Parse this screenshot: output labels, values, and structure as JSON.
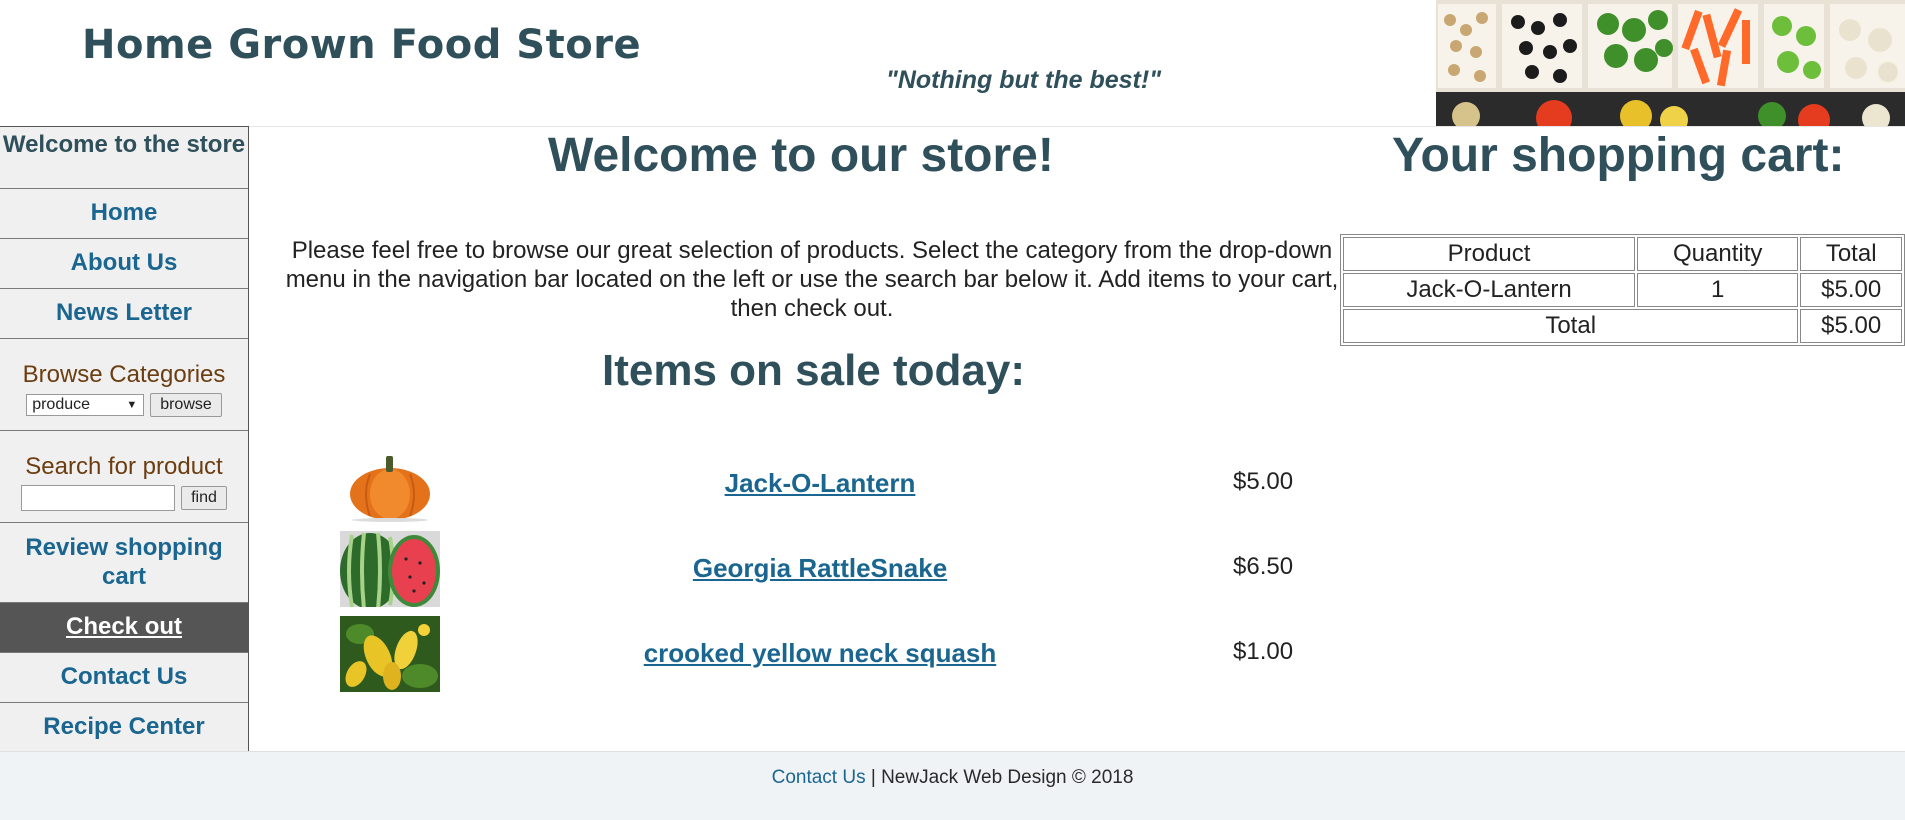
{
  "header": {
    "title": "Home Grown Food Store",
    "tagline": "\"Nothing but the best!\""
  },
  "sidebar": {
    "welcome": "Welcome to the store",
    "links": {
      "home": "Home",
      "about": "About Us",
      "newsletter": "News Letter",
      "review_cart": "Review shopping cart",
      "checkout": "Check out",
      "contact": "Contact Us",
      "recipes": "Recipe Center"
    },
    "browse": {
      "label": "Browse Categories",
      "selected": "produce",
      "button": "browse"
    },
    "search": {
      "label": "Search for product",
      "value": "",
      "button": "find"
    }
  },
  "main": {
    "heading": "Welcome to our store!",
    "intro": "Please feel free to browse our great selection of products. Select the category from the drop-down menu in the navigation bar located on the left or use the search bar below it. Add items to your cart, then check out.",
    "sale_heading": "Items on sale today:",
    "products": [
      {
        "name": "Jack-O-Lantern",
        "price": "$5.00",
        "image": "pumpkin"
      },
      {
        "name": "Georgia RattleSnake",
        "price": "$6.50",
        "image": "watermelon"
      },
      {
        "name": "crooked yellow neck squash",
        "price": "$1.00",
        "image": "yellow-squash"
      }
    ]
  },
  "cart": {
    "heading": "Your shopping cart:",
    "columns": [
      "Product",
      "Quantity",
      "Total"
    ],
    "rows": [
      {
        "product": "Jack-O-Lantern",
        "quantity": "1",
        "total": "$5.00"
      }
    ],
    "total_label": "Total",
    "total_value": "$5.00"
  },
  "footer": {
    "contact_link": "Contact Us",
    "text": " | NewJack Web Design © 2018"
  },
  "colors": {
    "heading": "#2f4f5a",
    "link": "#1a6690",
    "sidebar_bg": "#f0f0f0",
    "checkout_bg": "#555555",
    "category_label": "#6b3d10",
    "footer_bg": "#f0f3f5"
  }
}
